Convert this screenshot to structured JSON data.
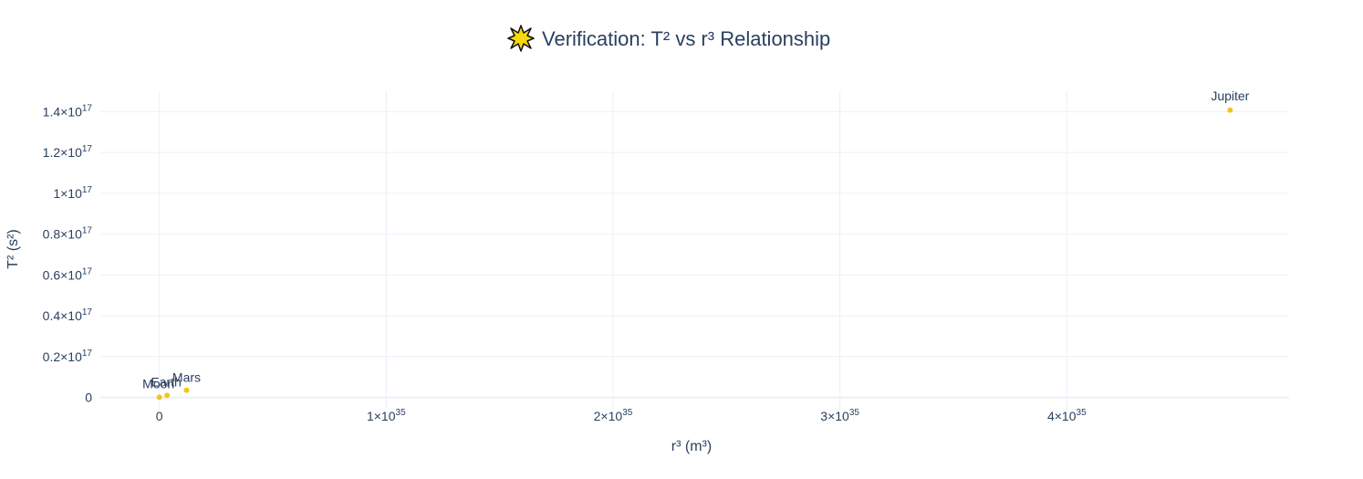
{
  "chart_data": {
    "type": "scatter",
    "title_icon": "burst-star-icon",
    "title": "Verification: T² vs r³ Relationship",
    "xlabel": "r³ (m³)",
    "ylabel": "T² (s²)",
    "x_exponent": 35,
    "y_exponent": 17,
    "xlim": [
      -0.26,
      4.98
    ],
    "ylim": [
      -0.06,
      1.5
    ],
    "x_ticks": [
      {
        "value": 0,
        "mantissa": "0",
        "exp": ""
      },
      {
        "value": 1,
        "mantissa": "1×10",
        "exp": "35"
      },
      {
        "value": 2,
        "mantissa": "2×10",
        "exp": "35"
      },
      {
        "value": 3,
        "mantissa": "3×10",
        "exp": "35"
      },
      {
        "value": 4,
        "mantissa": "4×10",
        "exp": "35"
      }
    ],
    "y_ticks": [
      {
        "value": 0,
        "mantissa": "0",
        "exp": ""
      },
      {
        "value": 0.2,
        "mantissa": "0.2×10",
        "exp": "17"
      },
      {
        "value": 0.4,
        "mantissa": "0.4×10",
        "exp": "17"
      },
      {
        "value": 0.6,
        "mantissa": "0.6×10",
        "exp": "17"
      },
      {
        "value": 0.8,
        "mantissa": "0.8×10",
        "exp": "17"
      },
      {
        "value": 1.0,
        "mantissa": "1×10",
        "exp": "17"
      },
      {
        "value": 1.2,
        "mantissa": "1.2×10",
        "exp": "17"
      },
      {
        "value": 1.4,
        "mantissa": "1.4×10",
        "exp": "17"
      }
    ],
    "series": [
      {
        "marker_color": "#f5c518",
        "points": [
          {
            "label": "Moon",
            "x": 0.0002,
            "y": 0.0007
          },
          {
            "label": "Earth",
            "x": 0.034,
            "y": 0.01
          },
          {
            "label": "Mars",
            "x": 0.12,
            "y": 0.035
          },
          {
            "label": "Jupiter",
            "x": 4.72,
            "y": 1.407
          }
        ]
      }
    ],
    "grid": true,
    "legend": "none"
  },
  "colors": {
    "text": "#2a3f5f",
    "grid": "#ebf0f8",
    "marker": "#f5c518",
    "background": "#ffffff"
  }
}
